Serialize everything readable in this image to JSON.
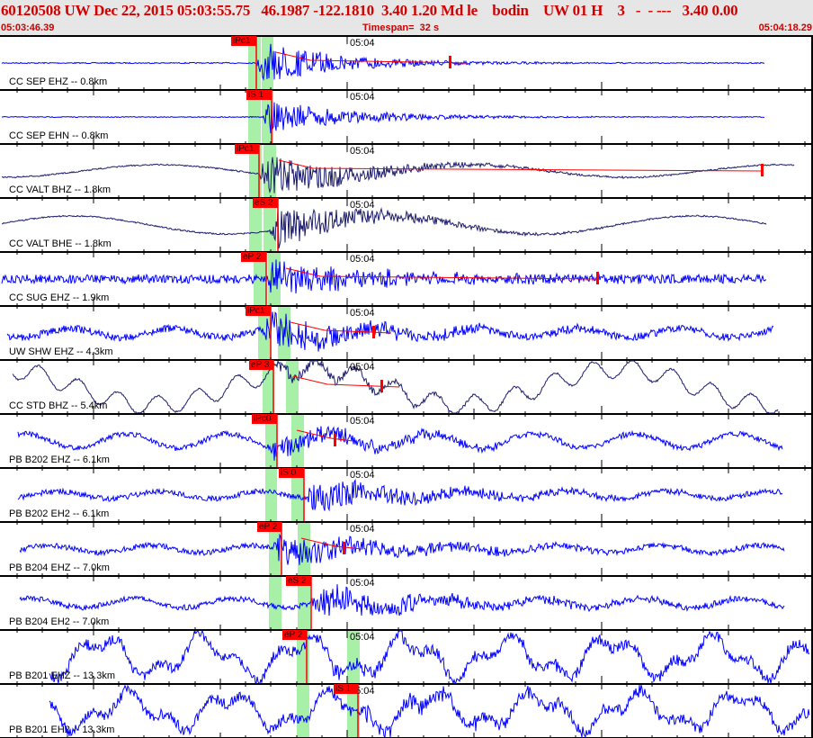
{
  "header": {
    "title": "60120508 UW Dec 22, 2015 05:03:55.75   46.1987 -122.1810  3.40 1.20 Md le    bodin    UW 01 H    3   -  - ---   3.40 0.00",
    "start_time": "05:03:46.39",
    "timespan": "Timespan=  32 s",
    "end_time": "05:04:18.29"
  },
  "minute_label": "05:04",
  "colors": {
    "header_text": "#d00000",
    "trace_short_period": "#0000ff",
    "trace_broadband": "#1c1c6e",
    "pick": "#ff0000",
    "window": "#a8f0a8",
    "coda": "#ff0000"
  },
  "channels": [
    {
      "label": "CC SEP EHZ -- 0.8km",
      "pick": "iPc1"
    },
    {
      "label": "CC SEP EHN -- 0.8km",
      "pick": "iS 1"
    },
    {
      "label": "CC VALT BHZ -- 1.8km",
      "pick": "iPc1"
    },
    {
      "label": "CC VALT BHE -- 1.8km",
      "pick": "eS 2"
    },
    {
      "label": "CC SUG EHZ -- 1.9km",
      "pick": "eP 2"
    },
    {
      "label": "UW SHW EHZ -- 4.3km",
      "pick": "iPc1"
    },
    {
      "label": "CC STD BHZ -- 5.4km",
      "pick": "eP 3"
    },
    {
      "label": "PB B202 EHZ -- 6.1km",
      "pick": "iPc0"
    },
    {
      "label": "PB B202 EH2 -- 6.1km",
      "pick": "iS 0"
    },
    {
      "label": "PB B204 EHZ -- 7.0km",
      "pick": "eP 2"
    },
    {
      "label": "PB B204 EH2 -- 7.0km",
      "pick": "eS 2"
    },
    {
      "label": "PB B201 EHZ -- 13.3km",
      "pick": "eP 2"
    },
    {
      "label": "PB B201 EH2 -- 13.3km",
      "pick": "iS 1"
    }
  ]
}
